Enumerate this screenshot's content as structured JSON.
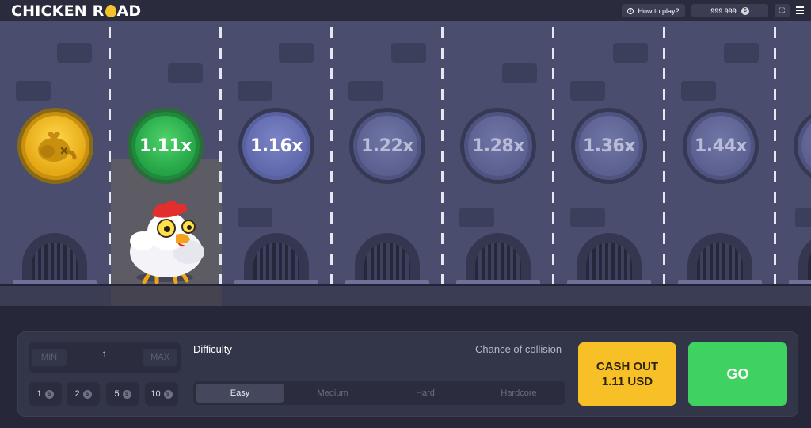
{
  "header": {
    "logo_left": "CHICKEN R",
    "logo_right": "AD",
    "how_to_play": "How to play?",
    "balance": "999 999",
    "currency_symbol": "$"
  },
  "lanes": [
    {
      "state": "done",
      "label": ""
    },
    {
      "state": "active",
      "label": "1.11x"
    },
    {
      "state": "next",
      "label": "1.16x"
    },
    {
      "state": "locked",
      "label": "1.22x"
    },
    {
      "state": "locked",
      "label": "1.28x"
    },
    {
      "state": "locked",
      "label": "1.36x"
    },
    {
      "state": "locked",
      "label": "1.44x"
    },
    {
      "state": "locked",
      "label": ""
    }
  ],
  "controls": {
    "min_label": "MIN",
    "max_label": "MAX",
    "bet_value": "1",
    "quick_bets": [
      "1",
      "2",
      "5",
      "10"
    ],
    "difficulty_label": "Difficulty",
    "chance_label": "Chance of collision",
    "difficulty_options": [
      "Easy",
      "Medium",
      "Hard",
      "Hardcore"
    ],
    "selected_difficulty": "Easy",
    "cashout_line1": "CASH OUT",
    "cashout_line2": "1.11 USD",
    "go_label": "GO"
  },
  "colors": {
    "go": "#40d260",
    "cashout": "#f7c026",
    "active_coin": "#24a446",
    "done_coin": "#e6a815"
  }
}
